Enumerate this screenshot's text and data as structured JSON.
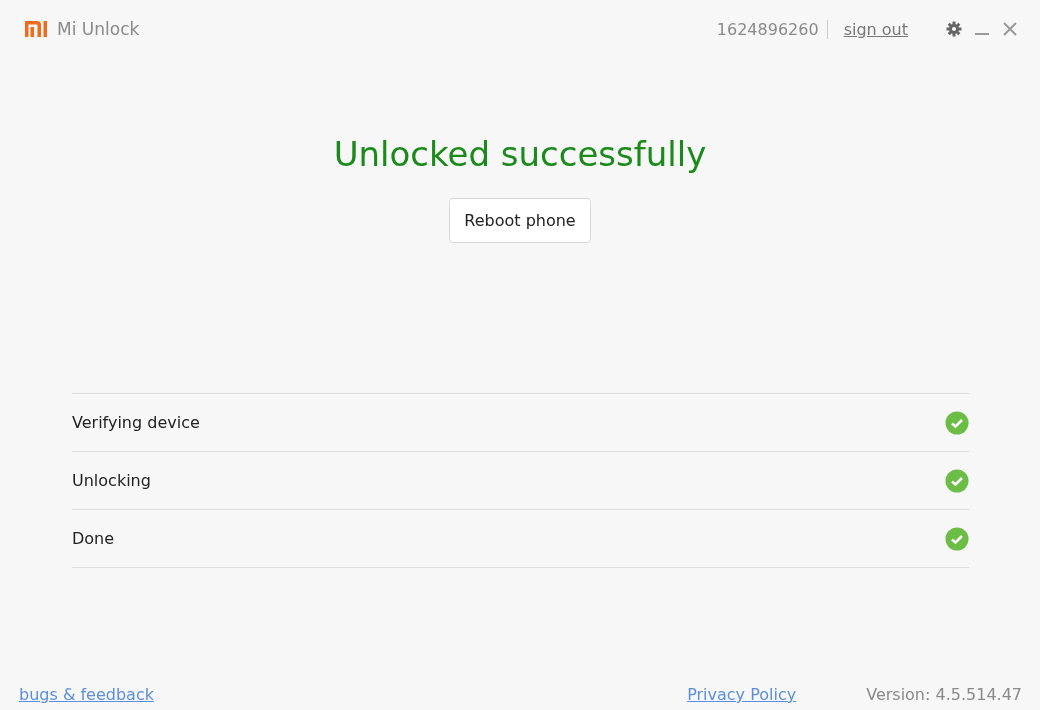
{
  "window": {
    "title": "Mi Unlock"
  },
  "account": {
    "id": "1624896260",
    "sign_out": "sign out"
  },
  "status": {
    "title": "Unlocked successfully",
    "button": "Reboot phone"
  },
  "steps": [
    {
      "label": "Verifying device",
      "done": true
    },
    {
      "label": "Unlocking",
      "done": true
    },
    {
      "label": "Done",
      "done": true
    }
  ],
  "footer": {
    "feedback": "bugs & feedback",
    "privacy": "Privacy Policy",
    "version": "Version: 4.5.514.47"
  }
}
